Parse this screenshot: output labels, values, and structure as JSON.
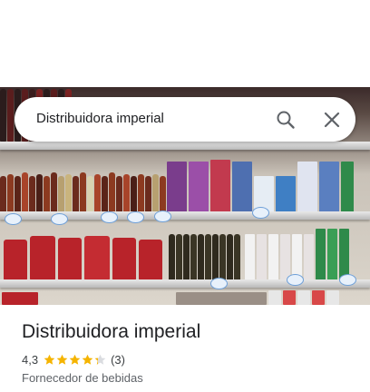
{
  "search": {
    "query": "Distribuidora imperial"
  },
  "place": {
    "name": "Distribuidora imperial",
    "rating": "4,3",
    "rating_value": 4.3,
    "stars_max": 5,
    "review_count": "(3)",
    "category": "Fornecedor de bebidas"
  },
  "colors": {
    "star": "#f5b400",
    "star_empty": "#dadce0",
    "title_text": "#202124",
    "secondary_text": "#5f6368"
  },
  "icons": {
    "search": "search-icon",
    "close": "close-icon",
    "star": "star-icon"
  }
}
